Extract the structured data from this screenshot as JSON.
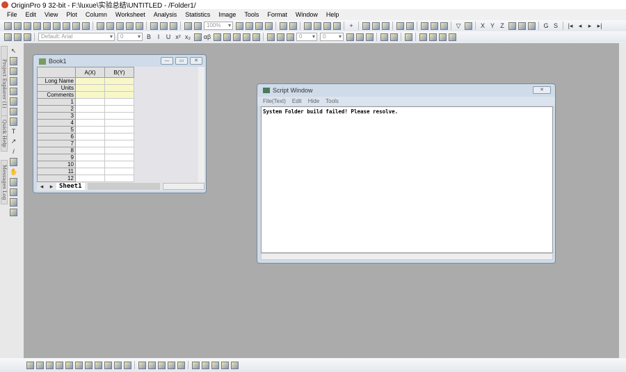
{
  "title": "OriginPro 9 32-bit - F:\\luxue\\实验总结\\UNTITLED - /Folder1/",
  "menu": [
    "File",
    "Edit",
    "View",
    "Plot",
    "Column",
    "Worksheet",
    "Analysis",
    "Statistics",
    "Image",
    "Tools",
    "Format",
    "Window",
    "Help"
  ],
  "toolbar1": {
    "icons": [
      "new-project-icon",
      "new-workbook-icon",
      "new-matrix-icon",
      "new-graph-icon",
      "new-function-icon",
      "new-excel-icon",
      "new-layout-icon",
      "new-notes-icon",
      "new-function-plot-icon",
      "|",
      "open-icon",
      "open-template-icon",
      "open-excel-icon",
      "save-icon",
      "save-template-icon",
      "|",
      "import-ascii-icon",
      "import-multiple-icon",
      "import-wizard-icon",
      "|",
      "recalculate-icon",
      "batch-icon"
    ],
    "zoom": "100%",
    "icons2": [
      "print-icon",
      "export-graph-icon",
      "copy-page-icon",
      "slide-show-icon",
      "|",
      "results-log-icon",
      "script-window-icon",
      "|",
      "project-explorer-icon",
      "code-builder-icon",
      "command-window-icon",
      "message-log-icon",
      "|",
      "add-column-icon",
      "|",
      "set-column-values-icon",
      "statistics-icon",
      "sort-icon",
      "|",
      "column-stats-icon",
      "row-stats-icon",
      "|",
      "bar-chart-icon",
      "column-chart-icon",
      "pie-icon",
      "|",
      "filter-icon",
      "clear-filter-icon",
      "|",
      "set-x-icon",
      "set-y-icon",
      "set-z-icon",
      "set-error-icon",
      "set-label-icon",
      "disregard-icon",
      "|",
      "group-icon",
      "subgroup-icon",
      "|",
      "first-icon",
      "prev-icon",
      "next-icon",
      "last-icon"
    ]
  },
  "toolbar2": {
    "font": "Default: Arial",
    "font_size": "0",
    "icons": [
      "bold-icon",
      "italic-icon",
      "underline-icon",
      "superscript-icon",
      "subscript-icon",
      "supersubscript-icon",
      "greek-icon",
      "increase-font-icon",
      "decrease-font-icon",
      "left-align-icon",
      "column-align-icon",
      "font-color-icon",
      "|",
      "fill-color-icon",
      "pattern-icon",
      "line-color-icon"
    ],
    "line_width": "0",
    "pattern_size": "0"
  },
  "left_panel": {
    "tabs": [
      "Project Explorer (1)",
      "Quick Help",
      "Messages Log"
    ],
    "tools": [
      "pointer-icon",
      "zoom-in-icon",
      "zoom-out-icon",
      "screen-reader-icon",
      "data-reader-icon",
      "data-selector-icon",
      "mask-icon",
      "draw-data-icon",
      "text-tool-icon",
      "arrow-tool-icon",
      "line-tool-icon",
      "rectangle-tool-icon",
      "hand-icon",
      "region-icon",
      "graph-region-icon",
      "region2-icon",
      "cube-icon"
    ]
  },
  "book": {
    "title": "Book1",
    "columns": [
      "A(X)",
      "B(Y)"
    ],
    "header_rows": [
      "Long Name",
      "Units",
      "Comments"
    ],
    "rows": [
      "1",
      "2",
      "3",
      "4",
      "5",
      "6",
      "7",
      "8",
      "9",
      "10",
      "11",
      "12"
    ],
    "sheet": "Sheet1"
  },
  "script": {
    "title": "Script Window",
    "menu": [
      "File(Text)",
      "Edit",
      "Hide",
      "Tools"
    ],
    "text": "System Folder build failed! Please resolve."
  },
  "bottom_icons": [
    "line-plot-icon",
    "scatter-icon",
    "line-symbol-icon",
    "column-plot-icon",
    "box-plot-icon",
    "bar-plot-icon",
    "area-icon",
    "contour-icon",
    "polar-icon",
    "3d-plot-icon",
    "template-icon",
    "|",
    "layer-icon",
    "merge-icon",
    "extract-icon",
    "add-layer-icon",
    "arrange-icon",
    "|",
    "align-left-icon",
    "align-right-icon",
    "align-top-icon",
    "align-bottom-icon",
    "same-size-icon"
  ]
}
